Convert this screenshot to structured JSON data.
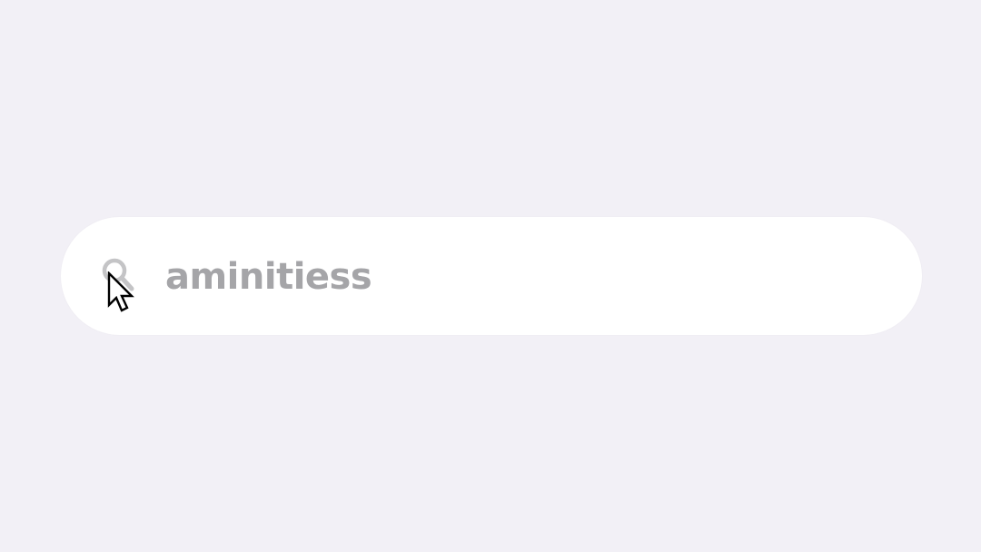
{
  "search": {
    "query": "aminitiess",
    "icon": "search-icon",
    "background_color": "#ffffff",
    "text_color": "#a5a5a8",
    "icon_color": "#c4c4c6"
  },
  "page": {
    "background_color": "#f2f0f6"
  },
  "cursor": {
    "icon": "mouse-pointer-icon"
  }
}
